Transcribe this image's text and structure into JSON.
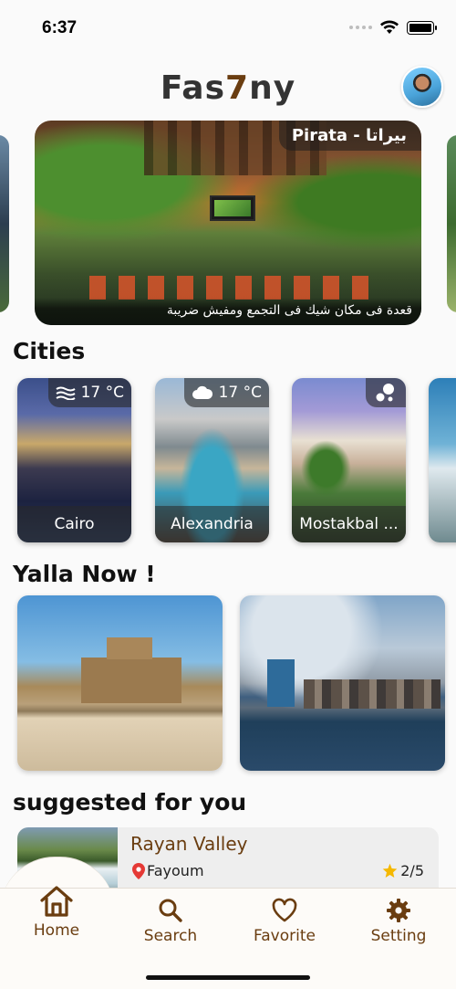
{
  "status_bar": {
    "time": "6:37"
  },
  "header": {
    "logo_part1": "Fas",
    "logo_accent": "7",
    "logo_part2": "ny"
  },
  "hero": {
    "title": "Pirata - بيراتا",
    "caption": "قعدة فى مكان شيك فى التجمع ومفيش ضريبة"
  },
  "cities": {
    "heading": "Cities",
    "items": [
      {
        "name": "Cairo",
        "weather_icon": "mist-icon",
        "temperature": "17 °C"
      },
      {
        "name": "Alexandria",
        "weather_icon": "cloud-icon",
        "temperature": "17 °C"
      },
      {
        "name": "Mostakbal ...",
        "weather_icon": "bubbles-icon",
        "temperature": ""
      }
    ]
  },
  "yalla_now": {
    "heading": "Yalla Now !"
  },
  "suggested": {
    "heading": "suggested for you",
    "items": [
      {
        "name": "Rayan Valley",
        "location": "Fayoum",
        "rating": "2/5"
      }
    ]
  },
  "bottom_nav": {
    "items": [
      {
        "label": "Home",
        "icon": "home-icon",
        "active": true
      },
      {
        "label": "Search",
        "icon": "search-icon",
        "active": false
      },
      {
        "label": "Favorite",
        "icon": "heart-icon",
        "active": false
      },
      {
        "label": "Setting",
        "icon": "gear-icon",
        "active": false
      }
    ]
  },
  "colors": {
    "brand_brown": "#6a3d10",
    "logo_gray": "#333333",
    "background": "#fafafa"
  }
}
